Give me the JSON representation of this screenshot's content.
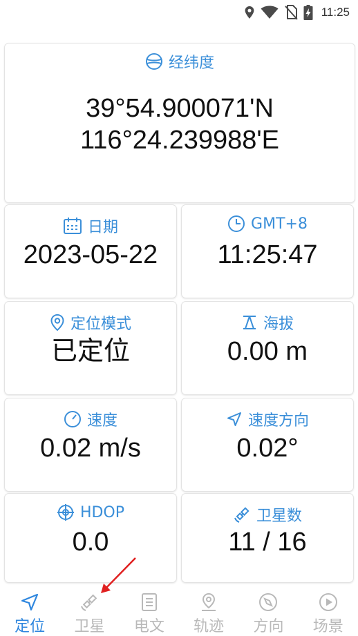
{
  "status_bar": {
    "time": "11:25"
  },
  "lat_lon": {
    "title": "经纬度",
    "latitude": "39°54.900071'N",
    "longitude": "116°24.239988'E"
  },
  "date": {
    "title": "日期",
    "value": "2023-05-22"
  },
  "time": {
    "title": "GMT+8",
    "value": "11:25:47"
  },
  "positioning_mode": {
    "title": "定位模式",
    "value": "已定位"
  },
  "altitude": {
    "title": "海拔",
    "value": "0.00 m"
  },
  "speed": {
    "title": "速度",
    "value": "0.02 m/s"
  },
  "speed_direction": {
    "title": "速度方向",
    "value": "0.02°"
  },
  "hdop": {
    "title": "HDOP",
    "value": "0.0"
  },
  "satellites": {
    "title": "卫星数",
    "value": "11 / 16"
  },
  "nav": {
    "items": [
      {
        "label": "定位",
        "icon": "navigation-arrow-icon",
        "active": true
      },
      {
        "label": "卫星",
        "icon": "satellite-icon",
        "active": false
      },
      {
        "label": "电文",
        "icon": "document-icon",
        "active": false
      },
      {
        "label": "轨迹",
        "icon": "location-pin-icon",
        "active": false
      },
      {
        "label": "方向",
        "icon": "compass-icon",
        "active": false
      },
      {
        "label": "场景",
        "icon": "play-icon",
        "active": false
      }
    ]
  },
  "colors": {
    "accent": "#3b8fd9",
    "inactive": "#b9b9b9",
    "annotation_arrow": "#e02020"
  }
}
